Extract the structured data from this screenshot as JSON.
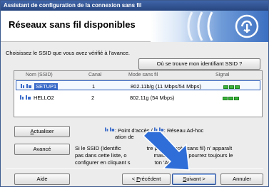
{
  "window": {
    "title": "Assistant de configuration de la connexion sans fil"
  },
  "header": {
    "title": "Réseaux sans fil disponibles"
  },
  "instruction": "Choisissez le SSID que vous avez vérifié à l'avance.",
  "buttons": {
    "missing_ssid": "Où se trouve mon identifiant SSID ?",
    "refresh_u": "A",
    "refresh_rest": "ctualiser",
    "advanced": "Avancé",
    "help": "Aide",
    "previous_prefix": "< ",
    "previous_u": "P",
    "previous_rest": "récédent",
    "next_u": "S",
    "next_rest": "uivant >",
    "cancel": "Annuler"
  },
  "list": {
    "columns": [
      "Nom (SSID)",
      "Canal",
      "Mode sans fil",
      "Signal"
    ],
    "rows": [
      {
        "ssid": "SETUP1",
        "channel": "1",
        "mode": "802.11b/g (11 Mbps/54 Mbps)",
        "signal_level": 3,
        "selected": true
      },
      {
        "ssid": "HELLO2",
        "channel": "2",
        "mode": "802.11g (54 Mbps)",
        "signal_level": 3,
        "selected": false
      }
    ]
  },
  "legend": {
    "line1": ": Point d'accès / ",
    "line1b": ": Réseau Ad-hoc",
    "line2": "ation de"
  },
  "note": {
    "line1": "Si le SSID (Identific",
    "line1b": "tre point d'accès sans fil) n' apparaît",
    "line2": "pas dans cette liste, o",
    "line2b": "masqué, vous pourrez toujours le",
    "line3": "configurer en cliquant s",
    "line3b": "ton 'Avancé'."
  },
  "colors": {
    "accent": "#3a6bc9",
    "arrow": "#2f6ed8",
    "signal": "#3db43d"
  },
  "icons": {
    "network": "wifi-network-icon",
    "adhoc": "adhoc-network-icon",
    "logo": "wireless-logo-icon",
    "arrow": "pointer-arrow-icon"
  }
}
